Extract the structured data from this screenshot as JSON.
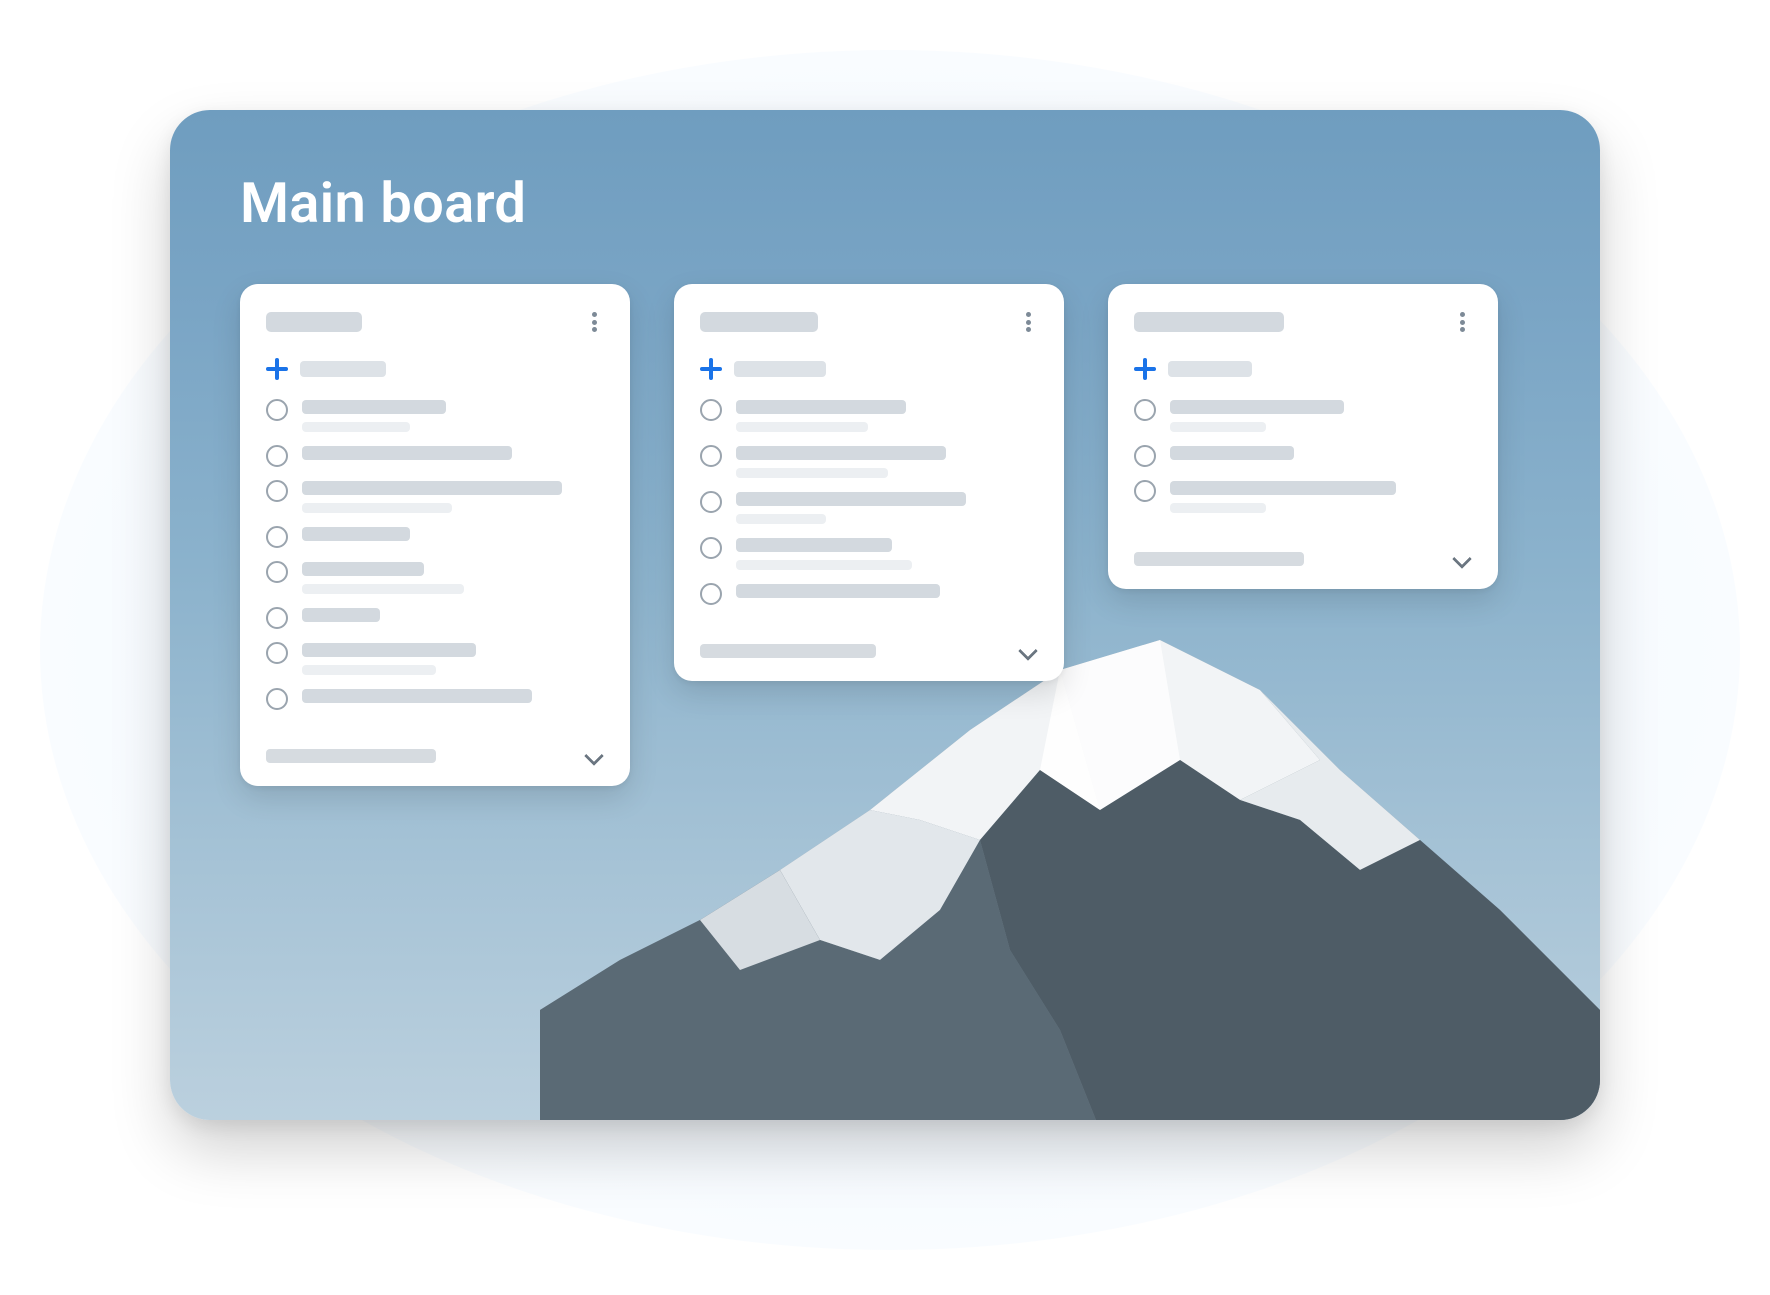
{
  "board": {
    "title": "Main board",
    "columns": [
      {
        "titleWidth": 96,
        "addWidth": 86,
        "tasks": [
          {
            "line1": 144,
            "line2": 108
          },
          {
            "line1": 210,
            "line2": 0
          },
          {
            "line1": 260,
            "line2": 150
          },
          {
            "line1": 108,
            "line2": 0
          },
          {
            "line1": 122,
            "line2": 162
          },
          {
            "line1": 78,
            "line2": 0
          },
          {
            "line1": 174,
            "line2": 134
          },
          {
            "line1": 230,
            "line2": 0
          }
        ],
        "footerWidth": 170
      },
      {
        "titleWidth": 118,
        "addWidth": 92,
        "tasks": [
          {
            "line1": 170,
            "line2": 132
          },
          {
            "line1": 210,
            "line2": 152
          },
          {
            "line1": 230,
            "line2": 90
          },
          {
            "line1": 156,
            "line2": 176
          },
          {
            "line1": 204,
            "line2": 0
          }
        ],
        "footerWidth": 176
      },
      {
        "titleWidth": 150,
        "addWidth": 84,
        "tasks": [
          {
            "line1": 174,
            "line2": 96
          },
          {
            "line1": 124,
            "line2": 0
          },
          {
            "line1": 226,
            "line2": 96
          }
        ],
        "footerWidth": 170
      }
    ]
  },
  "colors": {
    "accent": "#1a73e8",
    "placeholder": "#d3d9df",
    "placeholderLight": "#eceff2",
    "icon": "#7d8a97"
  }
}
